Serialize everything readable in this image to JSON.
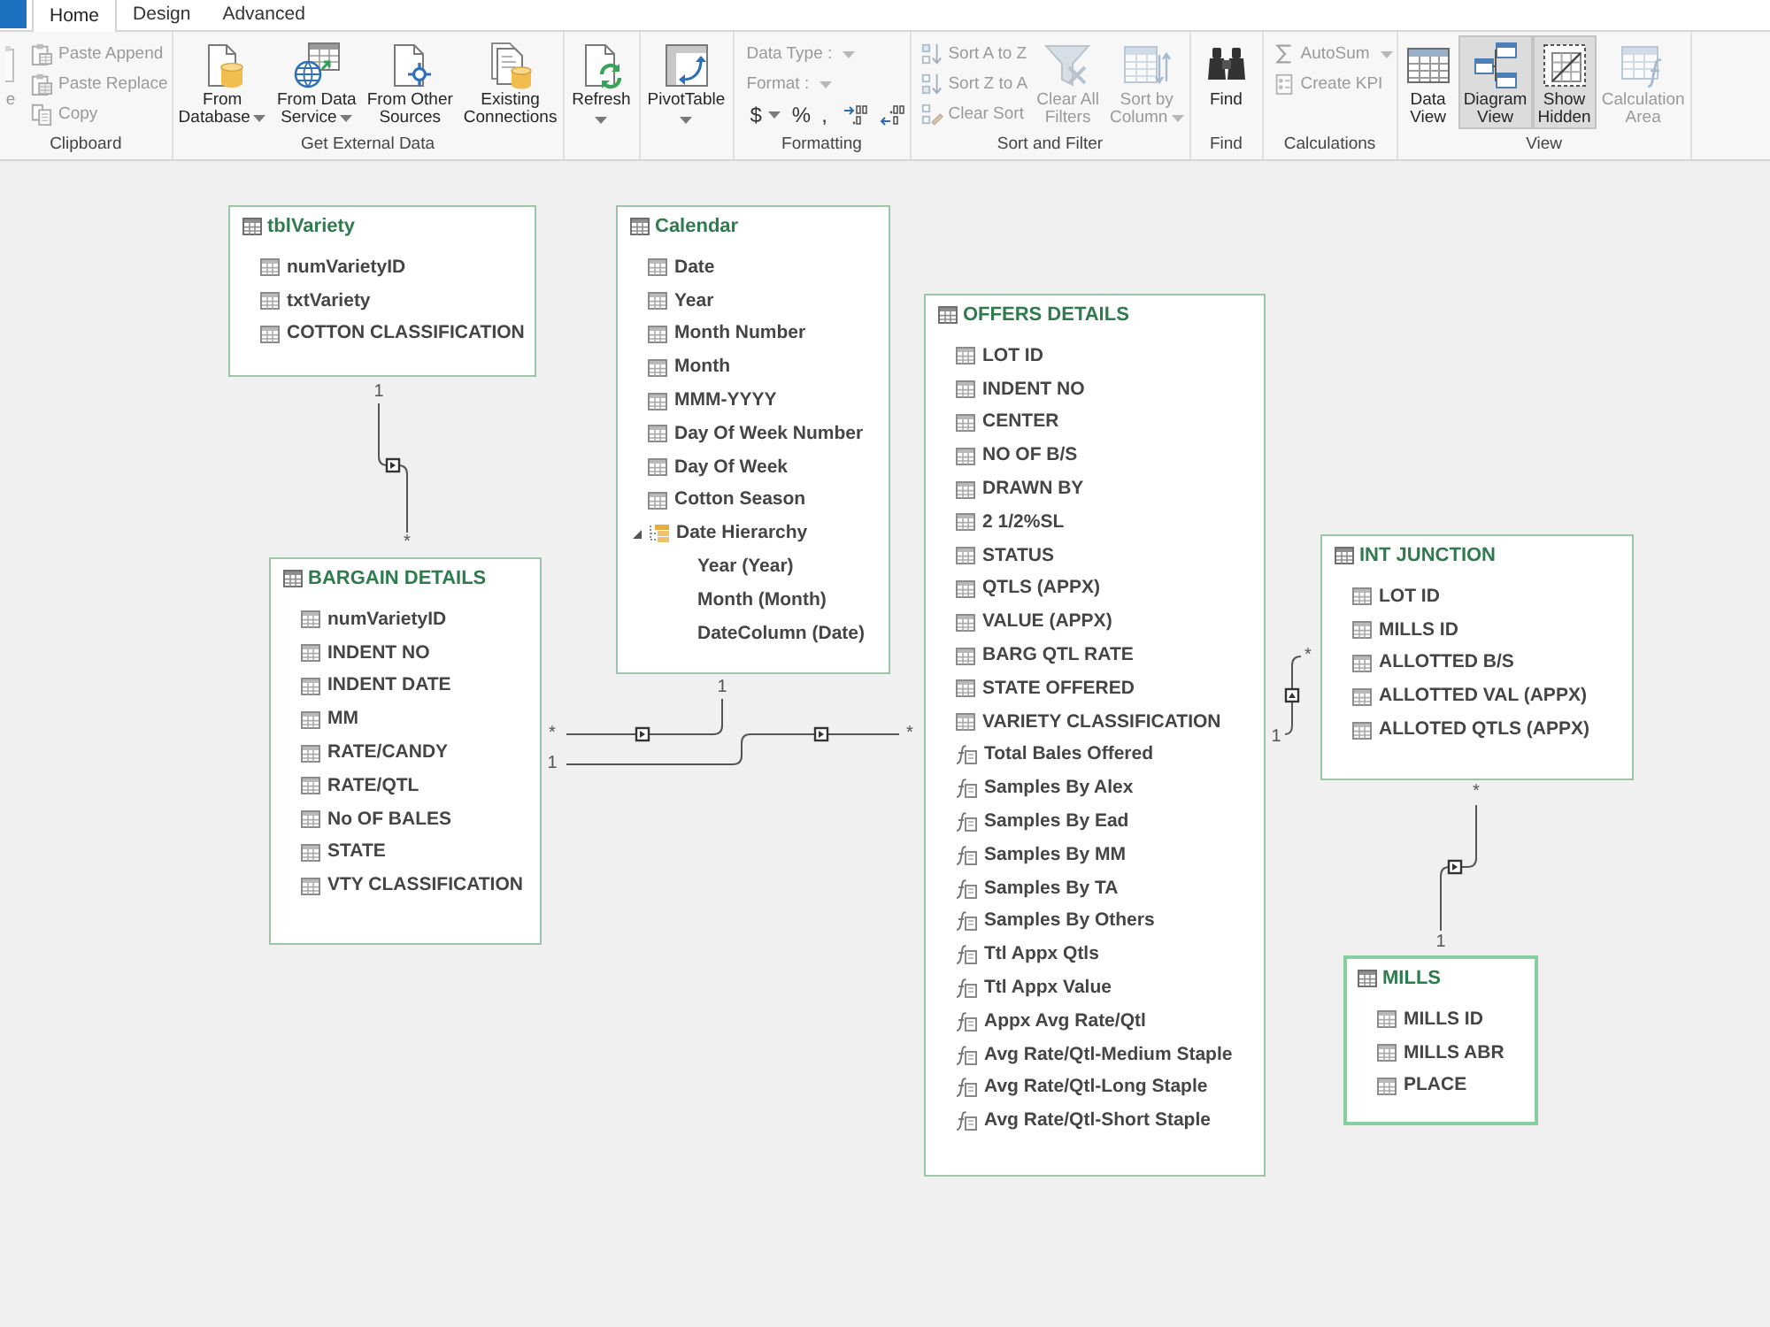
{
  "tabs": [
    {
      "label": "Home",
      "selected": true
    },
    {
      "label": "Design",
      "selected": false
    },
    {
      "label": "Advanced",
      "selected": false
    }
  ],
  "ribbon": [
    {
      "label": "Clipboard",
      "columns": [
        {
          "kind": "large",
          "lines": [
            "e"
          ],
          "dropdown": false,
          "disabled": true
        },
        {
          "kind": "stack",
          "items": [
            {
              "kind": "small",
              "label": "Paste Append",
              "dropdown": false,
              "disabled": true
            },
            {
              "kind": "small",
              "label": "Paste Replace",
              "dropdown": false,
              "disabled": true
            },
            {
              "kind": "small",
              "label": "Copy",
              "dropdown": false,
              "disabled": true
            }
          ]
        }
      ]
    },
    {
      "label": "Get External Data",
      "columns": [
        {
          "kind": "large",
          "lines": [
            "From",
            "Database"
          ],
          "dropdown": true,
          "disabled": false
        },
        {
          "kind": "large",
          "lines": [
            "From Data",
            "Service"
          ],
          "dropdown": true,
          "disabled": false
        },
        {
          "kind": "large",
          "lines": [
            "From Other",
            "Sources"
          ],
          "dropdown": false,
          "disabled": false
        },
        {
          "kind": "large",
          "lines": [
            "Existing",
            "Connections"
          ],
          "dropdown": false,
          "disabled": false
        }
      ]
    },
    {
      "columns": [
        {
          "kind": "large",
          "lines": [
            "Refresh"
          ],
          "dropdown": true,
          "disabled": false
        }
      ]
    },
    {
      "columns": [
        {
          "kind": "large",
          "lines": [
            "PivotTable"
          ],
          "dropdown": true,
          "disabled": false
        }
      ]
    },
    {
      "label": "Formatting",
      "columns": [
        {
          "kind": "stack",
          "items": [
            {
              "kind": "combo",
              "label": "Data Type :",
              "dropdown": true,
              "disabled": true
            },
            {
              "kind": "combo",
              "label": "Format :",
              "dropdown": true,
              "disabled": true
            },
            {
              "kind": "symbols",
              "symbols": [
                {
                  "label": "$",
                  "dropdown": true
                },
                {
                  "label": "%",
                  "dropdown": false
                },
                {
                  "label": ",",
                  "dropdown": false
                }
              ]
            }
          ]
        }
      ]
    },
    {
      "label": "Sort and Filter",
      "columns": [
        {
          "kind": "stack",
          "items": [
            {
              "kind": "small",
              "label": "Sort A to Z",
              "dropdown": false,
              "disabled": true
            },
            {
              "kind": "small",
              "label": "Sort Z to A",
              "dropdown": false,
              "disabled": true
            },
            {
              "kind": "small",
              "label": "Clear Sort",
              "dropdown": false,
              "disabled": true
            }
          ]
        },
        {
          "kind": "large",
          "lines": [
            "Clear All",
            "Filters"
          ],
          "dropdown": false,
          "disabled": true
        },
        {
          "kind": "large",
          "lines": [
            "Sort by",
            "Column"
          ],
          "dropdown": true,
          "disabled": true
        }
      ]
    },
    {
      "label": "Find",
      "columns": [
        {
          "kind": "large",
          "lines": [
            "Find"
          ],
          "dropdown": false,
          "disabled": false
        }
      ]
    },
    {
      "label": "Calculations",
      "columns": [
        {
          "kind": "stack",
          "items": [
            {
              "kind": "small",
              "label": "AutoSum",
              "dropdown": true,
              "disabled": true
            },
            {
              "kind": "small",
              "label": "Create KPI",
              "dropdown": false,
              "disabled": true
            }
          ]
        }
      ]
    },
    {
      "label": "View",
      "columns": [
        {
          "kind": "large",
          "lines": [
            "Data",
            "View"
          ],
          "dropdown": false,
          "disabled": false,
          "selected": false
        },
        {
          "kind": "large",
          "lines": [
            "Diagram",
            "View"
          ],
          "dropdown": false,
          "disabled": false,
          "selected": true
        },
        {
          "kind": "large",
          "lines": [
            "Show",
            "Hidden"
          ],
          "dropdown": false,
          "disabled": false,
          "selected": true
        },
        {
          "kind": "large",
          "lines": [
            "Calculation",
            "Area"
          ],
          "dropdown": false,
          "disabled": true,
          "selected": false
        }
      ]
    }
  ],
  "diagram": {
    "tables": [
      {
        "title": "tblVariety",
        "selected": false,
        "fields": [
          {
            "kind": "column",
            "name": "numVarietyID"
          },
          {
            "kind": "column",
            "name": "txtVariety"
          },
          {
            "kind": "column",
            "name": "COTTON CLASSIFICATION"
          }
        ]
      },
      {
        "title": "Calendar",
        "selected": false,
        "fields": [
          {
            "kind": "column",
            "name": "Date"
          },
          {
            "kind": "column",
            "name": "Year"
          },
          {
            "kind": "column",
            "name": "Month Number"
          },
          {
            "kind": "column",
            "name": "Month"
          },
          {
            "kind": "column",
            "name": "MMM-YYYY"
          },
          {
            "kind": "column",
            "name": "Day Of Week Number"
          },
          {
            "kind": "column",
            "name": "Day Of Week"
          },
          {
            "kind": "column",
            "name": "Cotton Season"
          },
          {
            "kind": "hierarchy",
            "name": "Date Hierarchy",
            "expanded": true,
            "children": [
              {
                "kind": "level",
                "name": "Year (Year)"
              },
              {
                "kind": "level",
                "name": "Month (Month)"
              },
              {
                "kind": "level",
                "name": "DateColumn (Date)"
              }
            ]
          }
        ]
      },
      {
        "title": "BARGAIN DETAILS",
        "selected": false,
        "fields": [
          {
            "kind": "column",
            "name": "numVarietyID"
          },
          {
            "kind": "column",
            "name": "INDENT NO"
          },
          {
            "kind": "column",
            "name": "INDENT DATE"
          },
          {
            "kind": "column",
            "name": "MM"
          },
          {
            "kind": "column",
            "name": "RATE/CANDY"
          },
          {
            "kind": "column",
            "name": "RATE/QTL"
          },
          {
            "kind": "column",
            "name": "No OF BALES"
          },
          {
            "kind": "column",
            "name": "STATE"
          },
          {
            "kind": "column",
            "name": "VTY CLASSIFICATION"
          }
        ]
      },
      {
        "title": "OFFERS DETAILS",
        "selected": false,
        "fields": [
          {
            "kind": "column",
            "name": "LOT ID"
          },
          {
            "kind": "column",
            "name": "INDENT NO"
          },
          {
            "kind": "column",
            "name": "CENTER"
          },
          {
            "kind": "column",
            "name": "NO OF B/S"
          },
          {
            "kind": "column",
            "name": "DRAWN BY"
          },
          {
            "kind": "column",
            "name": "2 1/2%SL"
          },
          {
            "kind": "column",
            "name": "STATUS"
          },
          {
            "kind": "column",
            "name": "QTLS (APPX)"
          },
          {
            "kind": "column",
            "name": "VALUE (APPX)"
          },
          {
            "kind": "column",
            "name": "BARG QTL RATE"
          },
          {
            "kind": "column",
            "name": "STATE OFFERED"
          },
          {
            "kind": "column",
            "name": "VARIETY CLASSIFICATION"
          },
          {
            "kind": "measure",
            "name": "Total Bales Offered"
          },
          {
            "kind": "measure",
            "name": "Samples By Alex"
          },
          {
            "kind": "measure",
            "name": "Samples By Ead"
          },
          {
            "kind": "measure",
            "name": "Samples By MM"
          },
          {
            "kind": "measure",
            "name": "Samples By TA"
          },
          {
            "kind": "measure",
            "name": "Samples By Others"
          },
          {
            "kind": "measure",
            "name": "Ttl Appx Qtls"
          },
          {
            "kind": "measure",
            "name": "Ttl Appx Value"
          },
          {
            "kind": "measure",
            "name": "Appx Avg Rate/Qtl"
          },
          {
            "kind": "measure",
            "name": "Avg Rate/Qtl-Medium Staple"
          },
          {
            "kind": "measure",
            "name": "Avg Rate/Qtl-Long Staple"
          },
          {
            "kind": "measure",
            "name": "Avg Rate/Qtl-Short Staple"
          }
        ]
      },
      {
        "title": "INT JUNCTION",
        "selected": false,
        "fields": [
          {
            "kind": "column",
            "name": "LOT ID"
          },
          {
            "kind": "column",
            "name": "MILLS ID"
          },
          {
            "kind": "column",
            "name": "ALLOTTED B/S"
          },
          {
            "kind": "column",
            "name": "ALLOTTED VAL (APPX)"
          },
          {
            "kind": "column",
            "name": "ALLOTED QTLS (APPX)"
          }
        ]
      },
      {
        "title": "MILLS",
        "selected": true,
        "fields": [
          {
            "kind": "column",
            "name": "MILLS ID"
          },
          {
            "kind": "column",
            "name": "MILLS ABR"
          },
          {
            "kind": "column",
            "name": "PLACE"
          }
        ]
      }
    ],
    "relationships": [
      {
        "ends": [
          "1",
          "*"
        ]
      },
      {
        "ends": [
          "1",
          "*"
        ]
      },
      {
        "ends": [
          "1",
          "*"
        ]
      },
      {
        "ends": [
          "1",
          "*"
        ]
      },
      {
        "ends": [
          "*",
          "1"
        ]
      }
    ]
  }
}
